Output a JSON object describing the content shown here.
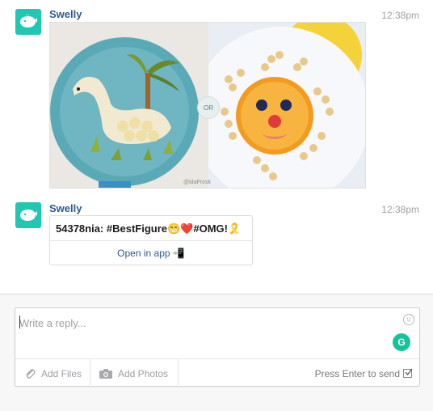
{
  "messages": [
    {
      "sender": "Swelly",
      "time": "12:38pm",
      "image": {
        "or_label": "OR",
        "watermark": "@idaFrosk"
      }
    },
    {
      "sender": "Swelly",
      "time": "12:38pm",
      "attachment": {
        "text": "54378nia: #BestFigure😁❤️#OMG!🎗️",
        "action_label": "Open in app 📲"
      }
    }
  ],
  "composer": {
    "placeholder": "Write a reply...",
    "grammarly_letter": "G",
    "add_files_label": "Add Files",
    "add_photos_label": "Add Photos",
    "send_hint": "Press Enter to send"
  },
  "colors": {
    "avatar": "#1fc8b2",
    "sender": "#2d5a8c",
    "grammarly": "#15c39a"
  }
}
